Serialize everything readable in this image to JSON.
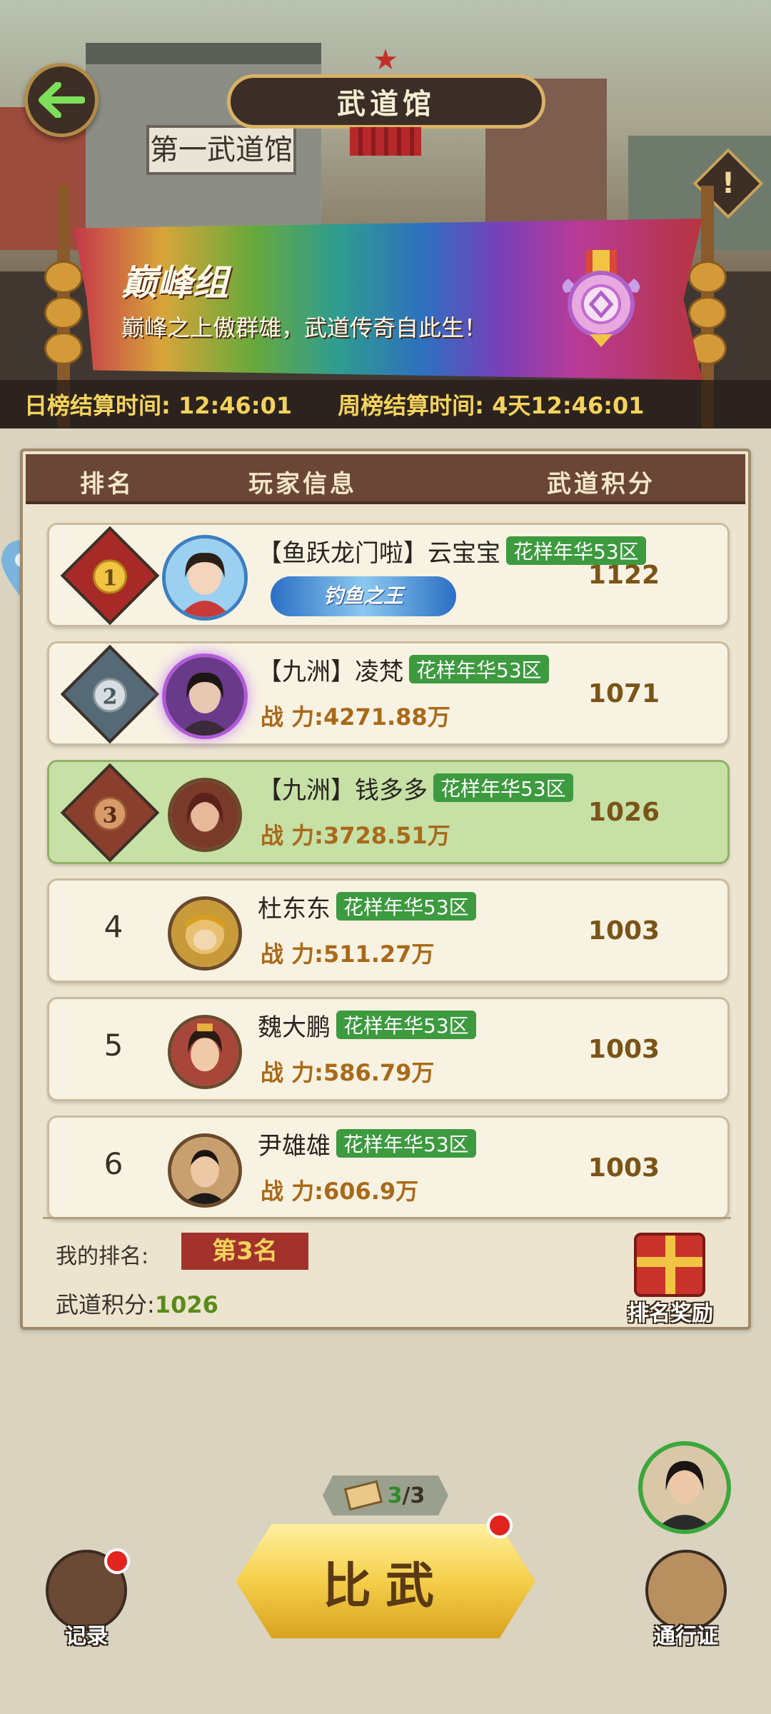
{
  "header": {
    "title": "武道馆",
    "plaque_text": "第一武道馆"
  },
  "banner": {
    "title": "巅峰组",
    "subtitle": "巅峰之上傲群雄，武道传奇自此生！"
  },
  "timers": {
    "daily": "日榜结算时间: 12:46:01",
    "weekly": "周榜结算时间: 4天12:46:01"
  },
  "table": {
    "col_rank": "排名",
    "col_player": "玩家信息",
    "col_score": "武道积分"
  },
  "rows": [
    {
      "rank": "1",
      "name": "【鱼跃龙门啦】云宝宝",
      "server": "花样年华53区",
      "title_badge": "钓鱼之王",
      "score": "1122"
    },
    {
      "rank": "2",
      "name": "【九洲】凌梵",
      "server": "花样年华53区",
      "power": "战 力:4271.88万",
      "score": "1071"
    },
    {
      "rank": "3",
      "name": "【九洲】钱多多",
      "server": "花样年华53区",
      "power": "战 力:3728.51万",
      "score": "1026"
    },
    {
      "rank": "4",
      "name": "杜东东",
      "server": "花样年华53区",
      "power": "战 力:511.27万",
      "score": "1003"
    },
    {
      "rank": "5",
      "name": "魏大鹏",
      "server": "花样年华53区",
      "power": "战 力:586.79万",
      "score": "1003"
    },
    {
      "rank": "6",
      "name": "尹雄雄",
      "server": "花样年华53区",
      "power": "战 力:606.9万",
      "score": "1003"
    }
  ],
  "mine": {
    "rank_label": "我的排名:",
    "rank_value": "第3名",
    "score_label": "武道积分:",
    "score_value": "1026"
  },
  "buttons": {
    "reward": "排名奖励",
    "fight": "比武",
    "record": "记录",
    "pass": "通行证"
  },
  "tickets": {
    "current": "3",
    "total": "/3"
  },
  "colors": {
    "accent_gold": "#f3d35c",
    "server_green": "#3d9a3f",
    "my_row_green": "#c6e0a6",
    "rank_red": "#a3322c"
  },
  "icons": [
    "back-arrow-icon",
    "info-icon",
    "medal-icon",
    "gift-icon",
    "ticket-icon",
    "book-icon",
    "scroll-icon",
    "map-pin-icon"
  ]
}
